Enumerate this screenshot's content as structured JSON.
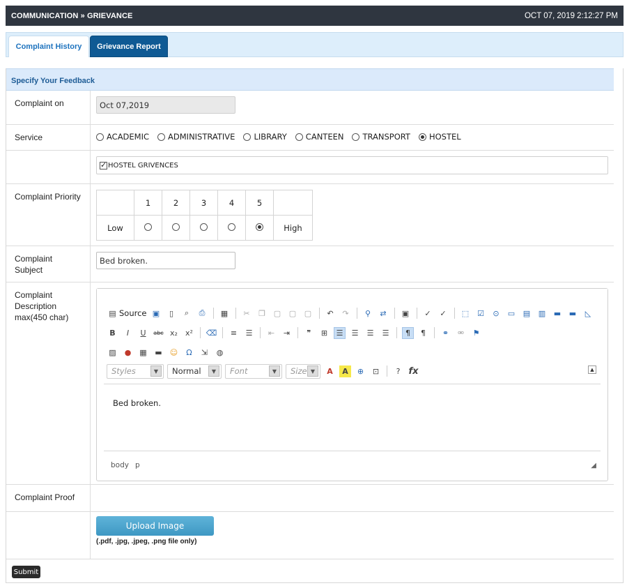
{
  "topbar": {
    "breadcrumb": "COMMUNICATION » GRIEVANCE",
    "datetime": "OCT 07, 2019  2:12:27 PM"
  },
  "tabs": [
    {
      "label": "Complaint History"
    },
    {
      "label": "Grievance Report"
    }
  ],
  "form": {
    "section_title": "Specify Your Feedback",
    "complaint_on": {
      "label": "Complaint on",
      "value": "Oct 07,2019"
    },
    "service": {
      "label": "Service",
      "options": [
        "ACADEMIC",
        "ADMINISTRATIVE",
        "LIBRARY",
        "CANTEEN",
        "TRANSPORT",
        "HOSTEL"
      ],
      "selected": "HOSTEL"
    },
    "sub_category": {
      "label": "HOSTEL GRIVENCES",
      "checked": true
    },
    "priority": {
      "label": "Complaint Priority",
      "levels": [
        "1",
        "2",
        "3",
        "4",
        "5"
      ],
      "low_label": "Low",
      "high_label": "High",
      "selected": "5"
    },
    "subject": {
      "label": "Complaint Subject",
      "value": "Bed broken."
    },
    "description": {
      "label": "Complaint Description max(450 char)",
      "value": "Bed broken.",
      "toolbar": {
        "source_label": "Source",
        "styles_placeholder": "Styles",
        "format_value": "Normal",
        "font_placeholder": "Font",
        "size_placeholder": "Size"
      },
      "status_path": [
        "body",
        "p"
      ]
    },
    "proof": {
      "label": "Complaint Proof",
      "upload_label": "Upload Image",
      "note": "(.pdf, .jpg, .jpeg, .png file only)"
    },
    "submit_label": "Submit"
  }
}
